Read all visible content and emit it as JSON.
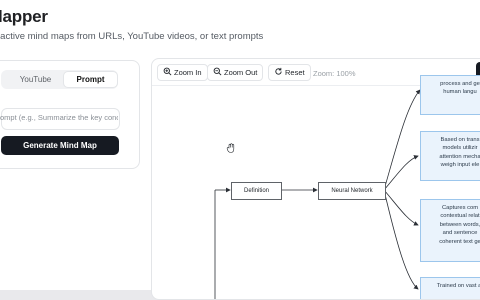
{
  "app": {
    "title": "lapper",
    "subtitle": "ractive mind maps from URLs, YouTube videos, or text prompts"
  },
  "input_panel": {
    "tabs": [
      {
        "label": "YouTube",
        "active": false
      },
      {
        "label": "Prompt",
        "active": true
      }
    ],
    "prompt_placeholder": "ompt (e.g., Summarize the key concep",
    "generate_button": "Generate Mind Map"
  },
  "toolbar": {
    "zoom_in": "Zoom In",
    "zoom_out": "Zoom Out",
    "reset": "Reset",
    "zoom_level": "Zoom: 100%"
  },
  "mind_map": {
    "nodes": {
      "definition": "Definition",
      "neural_network": "Neural Network"
    },
    "leaves": [
      {
        "lines": [
          "process and ge",
          "human langu"
        ]
      },
      {
        "lines": [
          "Based on trans",
          "models utilizir",
          "attention mecha",
          "weigh input ele"
        ]
      },
      {
        "lines": [
          "Captures com",
          "contextual relat",
          "between words,",
          "and sentence",
          "coherent text ge"
        ]
      },
      {
        "lines": [
          "Trained on vast ar"
        ]
      }
    ]
  }
}
